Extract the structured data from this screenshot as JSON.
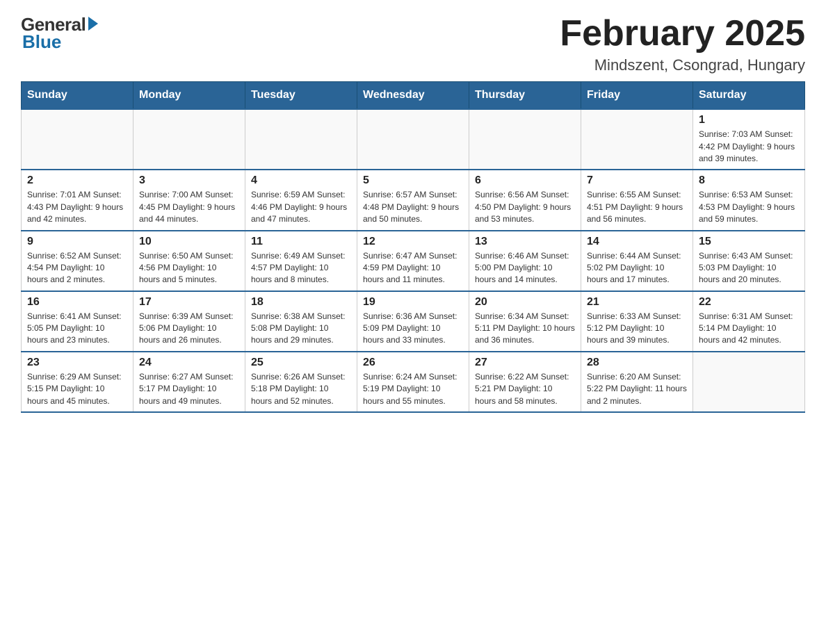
{
  "logo": {
    "general": "General",
    "blue": "Blue"
  },
  "header": {
    "title": "February 2025",
    "location": "Mindszent, Csongrad, Hungary"
  },
  "days_of_week": [
    "Sunday",
    "Monday",
    "Tuesday",
    "Wednesday",
    "Thursday",
    "Friday",
    "Saturday"
  ],
  "weeks": [
    [
      {
        "day": "",
        "info": ""
      },
      {
        "day": "",
        "info": ""
      },
      {
        "day": "",
        "info": ""
      },
      {
        "day": "",
        "info": ""
      },
      {
        "day": "",
        "info": ""
      },
      {
        "day": "",
        "info": ""
      },
      {
        "day": "1",
        "info": "Sunrise: 7:03 AM\nSunset: 4:42 PM\nDaylight: 9 hours and 39 minutes."
      }
    ],
    [
      {
        "day": "2",
        "info": "Sunrise: 7:01 AM\nSunset: 4:43 PM\nDaylight: 9 hours and 42 minutes."
      },
      {
        "day": "3",
        "info": "Sunrise: 7:00 AM\nSunset: 4:45 PM\nDaylight: 9 hours and 44 minutes."
      },
      {
        "day": "4",
        "info": "Sunrise: 6:59 AM\nSunset: 4:46 PM\nDaylight: 9 hours and 47 minutes."
      },
      {
        "day": "5",
        "info": "Sunrise: 6:57 AM\nSunset: 4:48 PM\nDaylight: 9 hours and 50 minutes."
      },
      {
        "day": "6",
        "info": "Sunrise: 6:56 AM\nSunset: 4:50 PM\nDaylight: 9 hours and 53 minutes."
      },
      {
        "day": "7",
        "info": "Sunrise: 6:55 AM\nSunset: 4:51 PM\nDaylight: 9 hours and 56 minutes."
      },
      {
        "day": "8",
        "info": "Sunrise: 6:53 AM\nSunset: 4:53 PM\nDaylight: 9 hours and 59 minutes."
      }
    ],
    [
      {
        "day": "9",
        "info": "Sunrise: 6:52 AM\nSunset: 4:54 PM\nDaylight: 10 hours and 2 minutes."
      },
      {
        "day": "10",
        "info": "Sunrise: 6:50 AM\nSunset: 4:56 PM\nDaylight: 10 hours and 5 minutes."
      },
      {
        "day": "11",
        "info": "Sunrise: 6:49 AM\nSunset: 4:57 PM\nDaylight: 10 hours and 8 minutes."
      },
      {
        "day": "12",
        "info": "Sunrise: 6:47 AM\nSunset: 4:59 PM\nDaylight: 10 hours and 11 minutes."
      },
      {
        "day": "13",
        "info": "Sunrise: 6:46 AM\nSunset: 5:00 PM\nDaylight: 10 hours and 14 minutes."
      },
      {
        "day": "14",
        "info": "Sunrise: 6:44 AM\nSunset: 5:02 PM\nDaylight: 10 hours and 17 minutes."
      },
      {
        "day": "15",
        "info": "Sunrise: 6:43 AM\nSunset: 5:03 PM\nDaylight: 10 hours and 20 minutes."
      }
    ],
    [
      {
        "day": "16",
        "info": "Sunrise: 6:41 AM\nSunset: 5:05 PM\nDaylight: 10 hours and 23 minutes."
      },
      {
        "day": "17",
        "info": "Sunrise: 6:39 AM\nSunset: 5:06 PM\nDaylight: 10 hours and 26 minutes."
      },
      {
        "day": "18",
        "info": "Sunrise: 6:38 AM\nSunset: 5:08 PM\nDaylight: 10 hours and 29 minutes."
      },
      {
        "day": "19",
        "info": "Sunrise: 6:36 AM\nSunset: 5:09 PM\nDaylight: 10 hours and 33 minutes."
      },
      {
        "day": "20",
        "info": "Sunrise: 6:34 AM\nSunset: 5:11 PM\nDaylight: 10 hours and 36 minutes."
      },
      {
        "day": "21",
        "info": "Sunrise: 6:33 AM\nSunset: 5:12 PM\nDaylight: 10 hours and 39 minutes."
      },
      {
        "day": "22",
        "info": "Sunrise: 6:31 AM\nSunset: 5:14 PM\nDaylight: 10 hours and 42 minutes."
      }
    ],
    [
      {
        "day": "23",
        "info": "Sunrise: 6:29 AM\nSunset: 5:15 PM\nDaylight: 10 hours and 45 minutes."
      },
      {
        "day": "24",
        "info": "Sunrise: 6:27 AM\nSunset: 5:17 PM\nDaylight: 10 hours and 49 minutes."
      },
      {
        "day": "25",
        "info": "Sunrise: 6:26 AM\nSunset: 5:18 PM\nDaylight: 10 hours and 52 minutes."
      },
      {
        "day": "26",
        "info": "Sunrise: 6:24 AM\nSunset: 5:19 PM\nDaylight: 10 hours and 55 minutes."
      },
      {
        "day": "27",
        "info": "Sunrise: 6:22 AM\nSunset: 5:21 PM\nDaylight: 10 hours and 58 minutes."
      },
      {
        "day": "28",
        "info": "Sunrise: 6:20 AM\nSunset: 5:22 PM\nDaylight: 11 hours and 2 minutes."
      },
      {
        "day": "",
        "info": ""
      }
    ]
  ]
}
